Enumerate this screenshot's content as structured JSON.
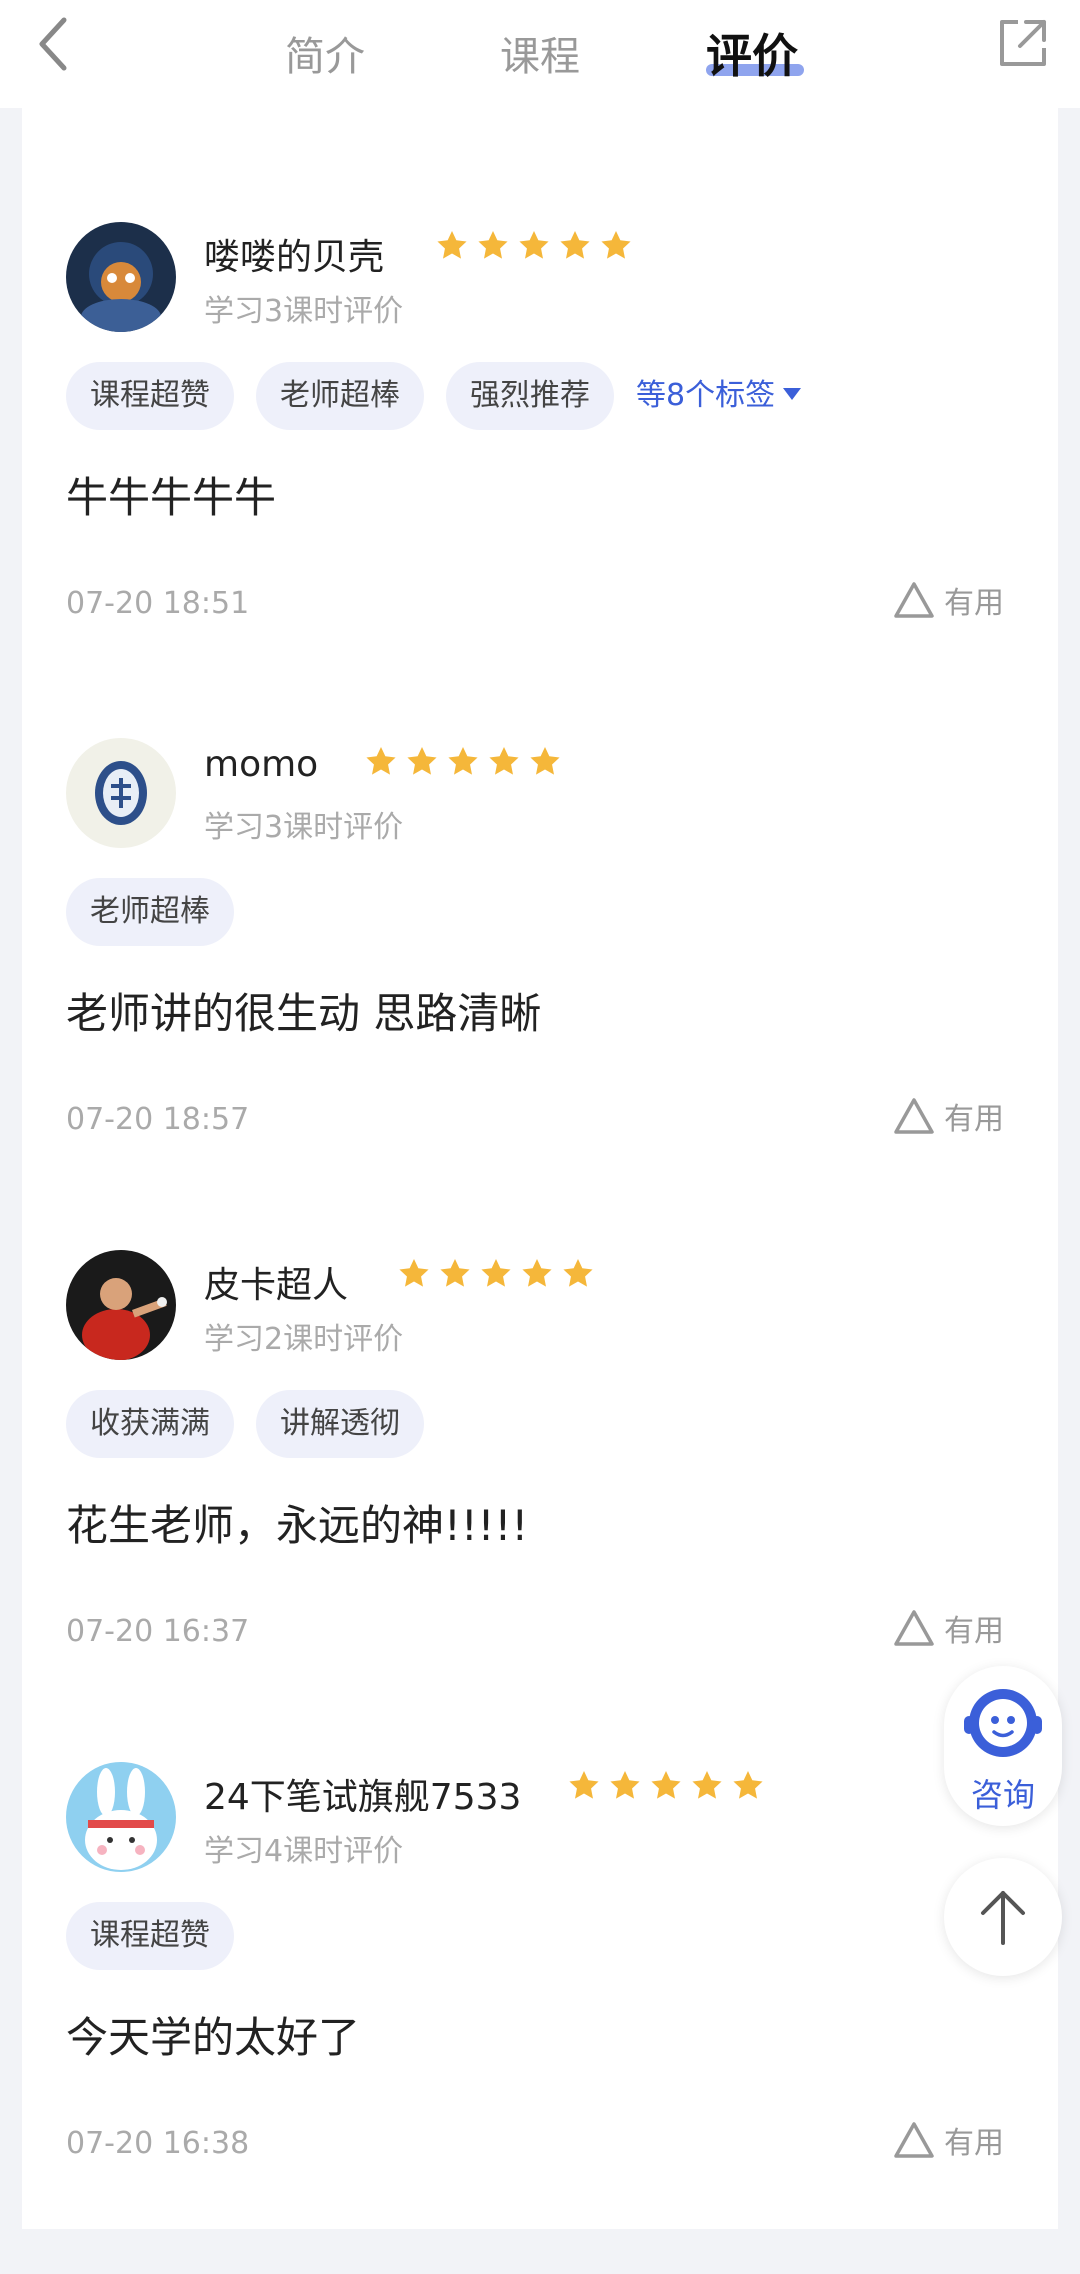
{
  "nav": {
    "tabs": [
      {
        "label": "简介",
        "active": false
      },
      {
        "label": "课程",
        "active": false
      },
      {
        "label": "评价",
        "active": true
      }
    ],
    "back_icon": "chevron-left-icon",
    "share_icon": "share-external-icon"
  },
  "colors": {
    "accent": "#3b5fd9",
    "star": "#f5b73a",
    "tag_bg": "#eef0fa",
    "muted": "#aaaaaa"
  },
  "reviews": [
    {
      "username": "喽喽的贝壳",
      "rating": 5,
      "meta": "学习3课时评价",
      "tags": [
        "课程超赞",
        "老师超棒",
        "强烈推荐"
      ],
      "more_tags": "等8个标签",
      "content": "牛牛牛牛牛",
      "time": "07-20 18:51",
      "useful": "有用"
    },
    {
      "username": "momo",
      "rating": 5,
      "meta": "学习3课时评价",
      "tags": [
        "老师超棒"
      ],
      "content": "老师讲的很生动 思路清晰",
      "time": "07-20 18:57",
      "useful": "有用"
    },
    {
      "username": "皮卡超人",
      "rating": 5,
      "meta": "学习2课时评价",
      "tags": [
        "收获满满",
        "讲解透彻"
      ],
      "content": "花生老师，永远的神!!!!!",
      "time": "07-20 16:37",
      "useful": "有用"
    },
    {
      "username": "24下笔试旗舰7533",
      "rating": 5,
      "meta": "学习4课时评价",
      "tags": [
        "课程超赞"
      ],
      "content": "今天学的太好了",
      "time": "07-20 16:38",
      "useful": "有用"
    }
  ],
  "floating": {
    "consult_label": "咨询",
    "consult_icon": "customer-service-icon",
    "top_icon": "arrow-up-icon"
  }
}
